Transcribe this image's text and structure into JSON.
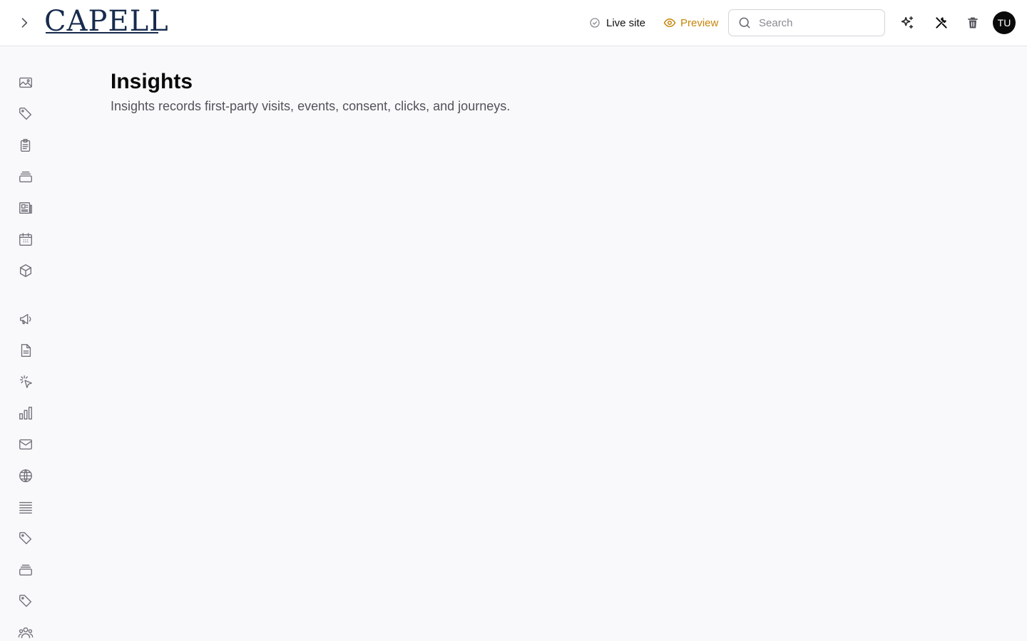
{
  "header": {
    "logo_text": "CAPELL",
    "live_site_label": "Live site",
    "preview_label": "Preview",
    "search": {
      "placeholder": "Search",
      "value": ""
    },
    "icons": [
      "chevron-right-icon",
      "sparkles-icon",
      "tools-icon",
      "trash-icon"
    ],
    "avatar_initials": "TU"
  },
  "sidebar": {
    "items": [
      "image-icon",
      "tag-icon",
      "clipboard-icon",
      "archive-icon",
      "newspaper-icon",
      "calendar-icon",
      "cube-icon",
      "megaphone-icon",
      "document-icon",
      "cursor-click-icon",
      "bar-chart-icon",
      "mail-icon",
      "globe-icon",
      "list-icon",
      "tag-icon",
      "archive-icon",
      "tag-icon",
      "users-icon"
    ]
  },
  "main": {
    "title": "Insights",
    "description": "Insights records first-party visits, events, consent, clicks, and journeys."
  },
  "colors": {
    "brand": "#172b4d",
    "preview": "#c7850a",
    "background": "#f9f9fb",
    "avatar": "#0a0a0a"
  }
}
